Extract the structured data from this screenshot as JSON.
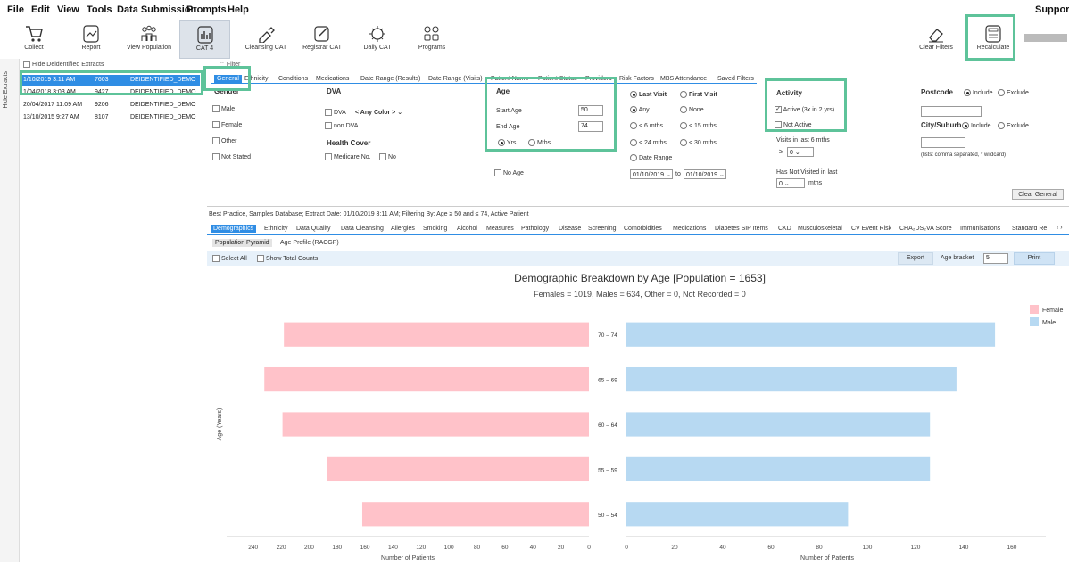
{
  "menu": [
    "File",
    "Edit",
    "View",
    "Tools",
    "Data Submission",
    "Prompts",
    "Help"
  ],
  "support": "Support",
  "toolbar": {
    "collect": "Collect",
    "report": "Report",
    "view_population": "View Population",
    "cat4": "CAT 4",
    "cleansing": "Cleansing CAT",
    "registrar": "Registrar CAT",
    "daily": "Daily CAT",
    "programs": "Programs",
    "clear_filters": "Clear Filters",
    "recalculate": "Recalculate"
  },
  "extracts": {
    "hide_deidentified": "Hide Deidentified Extracts",
    "hide_extracts_tab": "Hide Extracts",
    "rows": [
      {
        "date": "1/10/2019 3:11 AM",
        "count": "7603",
        "name": "DEIDENTIFIED_DEMO"
      },
      {
        "date": "1/04/2018 3:03 AM",
        "count": "9427",
        "name": "DEIDENTIFIED_DEMO"
      },
      {
        "date": "20/04/2017 11:09 AM",
        "count": "9206",
        "name": "DEIDENTIFIED_DEMO"
      },
      {
        "date": "13/10/2015 9:27 AM",
        "count": "8107",
        "name": "DEIDENTIFIED_DEMO"
      }
    ]
  },
  "filter": {
    "label": "Filter",
    "tabs": [
      "General",
      "Ethnicity",
      "Conditions",
      "Medications",
      "Date Range (Results)",
      "Date Range (Visits)",
      "Patient Name",
      "Patient Status",
      "Providers",
      "Risk Factors",
      "MBS Attendance",
      "Saved Filters"
    ],
    "gender": {
      "title": "Gender",
      "options": [
        "Male",
        "Female",
        "Other",
        "Not Stated"
      ]
    },
    "dva": {
      "title": "DVA",
      "dva": "DVA",
      "color": "< Any Color >",
      "non_dva": "non DVA"
    },
    "health_cover": {
      "title": "Health Cover",
      "medicare": "Medicare No.",
      "no": "No"
    },
    "age": {
      "title": "Age",
      "start_label": "Start Age",
      "start": "50",
      "end_label": "End Age",
      "end": "74",
      "yrs": "Yrs",
      "mths": "Mths",
      "no_age": "No Age"
    },
    "visit": {
      "last_visit": "Last Visit",
      "first_visit": "First Visit",
      "any": "Any",
      "none": "None",
      "lt6": "< 6 mths",
      "lt15": "< 15 mths",
      "lt24": "< 24 mths",
      "lt30": "< 30 mths",
      "date_range": "Date Range",
      "from": "01/10/2019",
      "to_label": "to",
      "to": "01/10/2019"
    },
    "activity": {
      "title": "Activity",
      "active": "Active (3x in 2 yrs)",
      "not_active": "Not Active",
      "visits_label": "Visits in last 6 mths",
      "gte": "≥",
      "visits_val": "0",
      "not_visited_label": "Has Not Visited in last",
      "not_visited_val": "0",
      "mths": "mths"
    },
    "postcode": {
      "title": "Postcode",
      "include": "Include",
      "exclude": "Exclude"
    },
    "city": {
      "title": "City/Suburb",
      "include": "Include",
      "exclude": "Exclude",
      "hint": "(lists: comma separated, * wildcard)"
    },
    "clear_general": "Clear General"
  },
  "info_line": "Best Practice, Samples Database; Extract Date: 01/10/2019 3:11 AM; Filtering By: Age ≥ 50 and ≤ 74, Active Patient",
  "report_tabs": [
    "Demographics",
    "Ethnicity",
    "Data Quality",
    "Data Cleansing",
    "Allergies",
    "Smoking",
    "Alcohol",
    "Measures",
    "Pathology",
    "Disease",
    "Screening",
    "Comorbidities",
    "Medications",
    "Diabetes SIP Items",
    "CKD",
    "Musculoskeletal",
    "CV Event Risk",
    "CHA₂DS₂VA Score",
    "Immunisations",
    "Standard Re"
  ],
  "sub_tabs": [
    "Population Pyramid",
    "Age Profile (RACGP)"
  ],
  "options_bar": {
    "select_all": "Select All",
    "show_total": "Show Total Counts",
    "export": "Export",
    "age_bracket": "Age bracket",
    "bracket_val": "5",
    "print": "Print"
  },
  "colors": {
    "female": "#ffc2c9",
    "male": "#b7d9f2",
    "highlight": "#5ec39a",
    "accent": "#2f8de4"
  },
  "chart_data": {
    "type": "bar",
    "orientation": "horizontal-pyramid",
    "title": "Demographic Breakdown by Age [Population = 1653]",
    "subtitle": "Females = 1019, Males = 634, Other = 0, Not Recorded = 0",
    "ylabel": "Age (Years)",
    "xlabel": "Number of Patients",
    "categories": [
      "70 – 74",
      "65 – 69",
      "60 – 64",
      "55 – 59",
      "50 – 54"
    ],
    "series": [
      {
        "name": "Female",
        "values": [
          218,
          232,
          219,
          187,
          162
        ]
      },
      {
        "name": "Male",
        "values": [
          153,
          137,
          126,
          126,
          92
        ]
      }
    ],
    "female_ticks": [
      240,
      220,
      200,
      180,
      160,
      140,
      120,
      100,
      80,
      60,
      40,
      20,
      0
    ],
    "male_ticks": [
      0,
      20,
      40,
      60,
      80,
      100,
      120,
      140,
      160
    ],
    "female_xlim": [
      0,
      250
    ],
    "male_xlim": [
      0,
      160
    ],
    "legend": "top-right"
  }
}
